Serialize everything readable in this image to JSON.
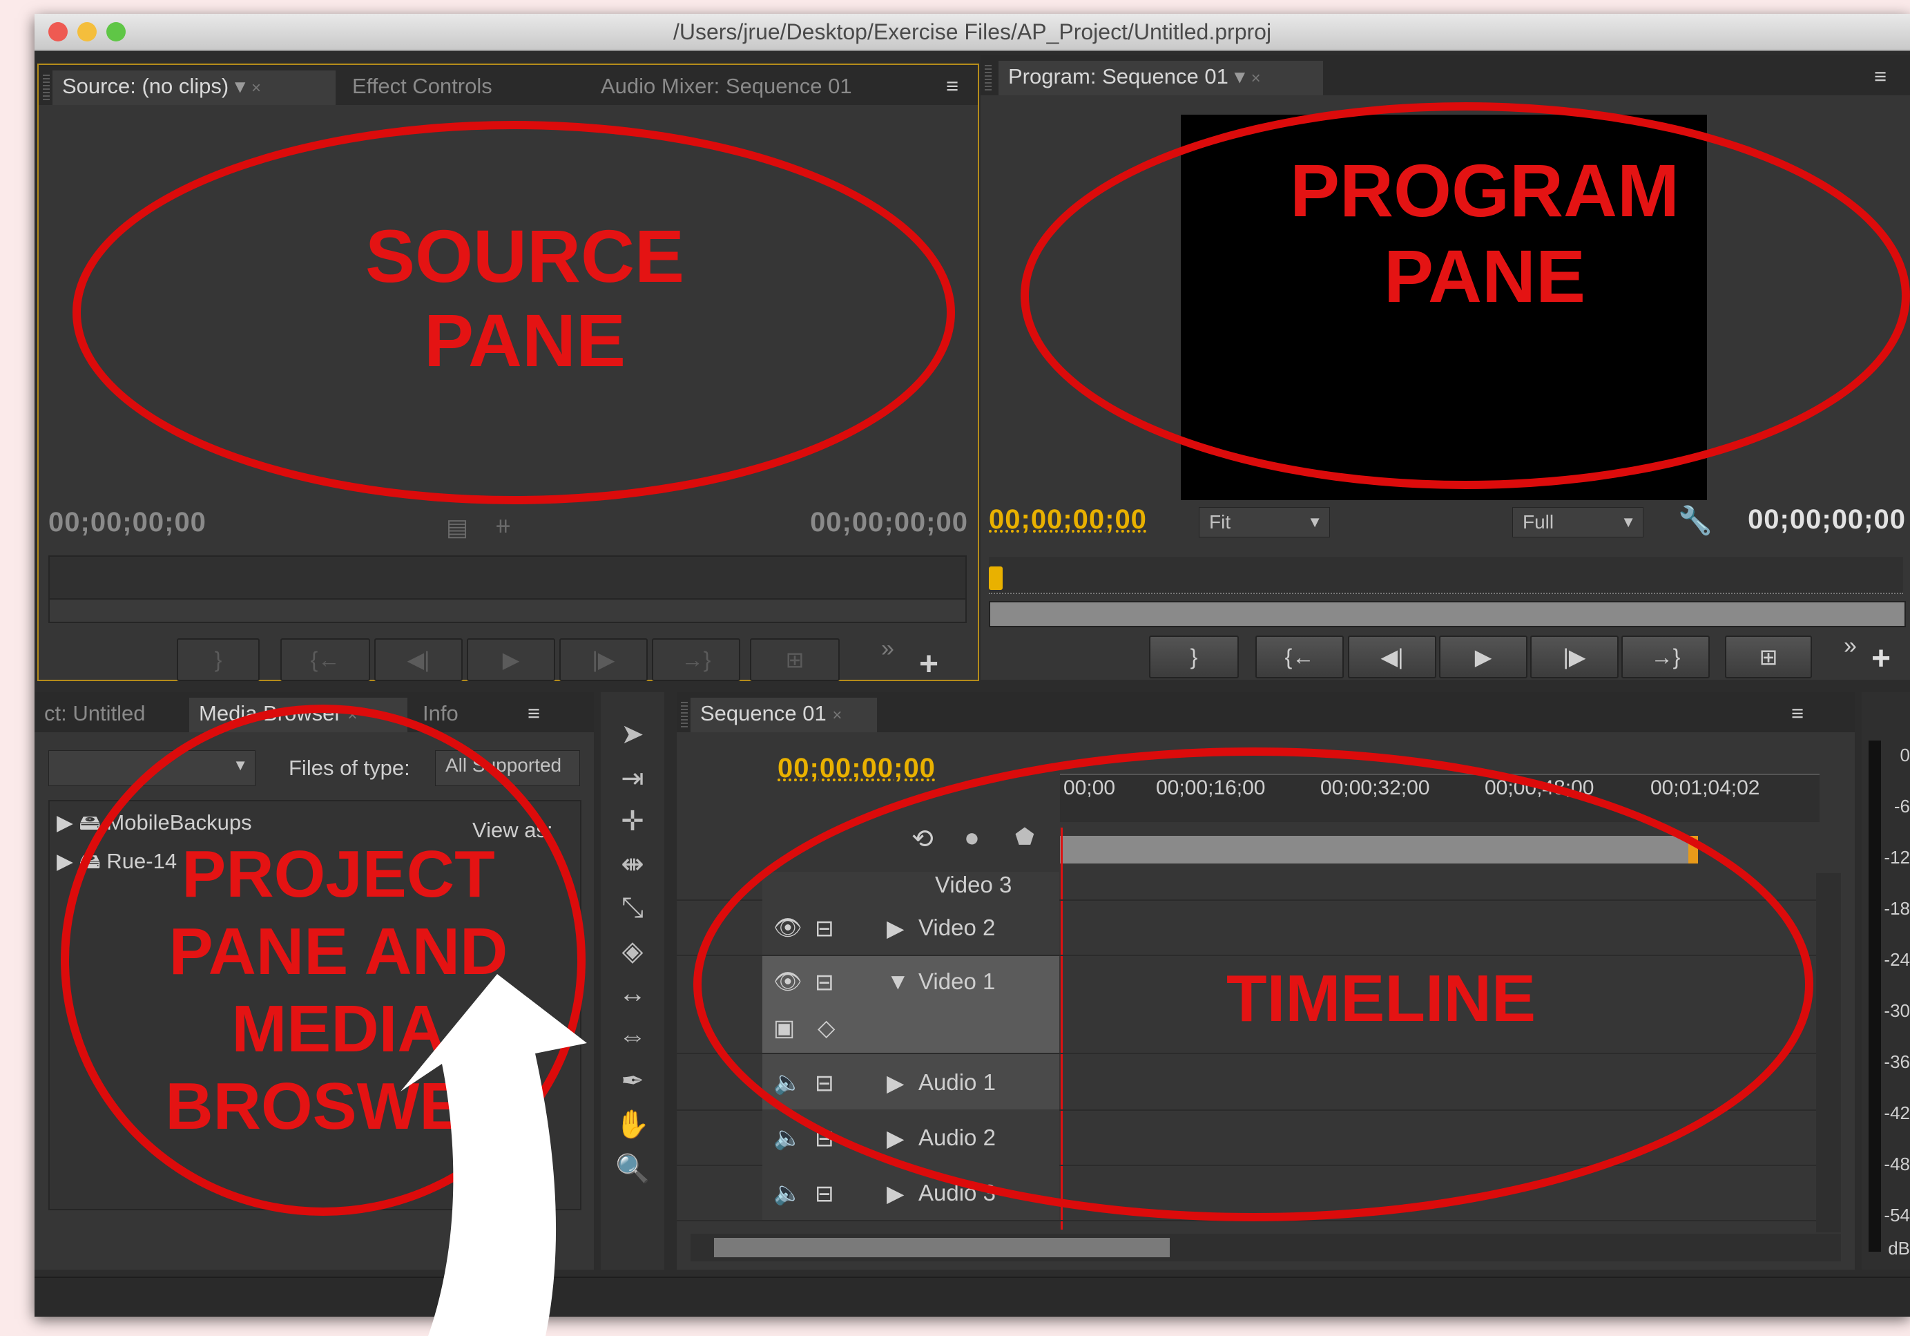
{
  "window": {
    "title": "/Users/jrue/Desktop/Exercise Files/AP_Project/Untitled.prproj"
  },
  "source": {
    "tabs": [
      "Source: (no clips)",
      "Effect Controls",
      "Audio Mixer: Sequence 01"
    ],
    "timecode_left": "00;00;00;00",
    "timecode_right": "00;00;00;00"
  },
  "program": {
    "tab": "Program: Sequence 01",
    "timecode_left": "00;00;00;00",
    "timecode_right": "00;00;00;00",
    "fit_label": "Fit",
    "quality_label": "Full"
  },
  "project": {
    "tabs": [
      "ct: Untitled",
      "Media Browser",
      "Info"
    ],
    "files_of_type_label": "Files of type:",
    "files_of_type_value": "All Supported",
    "view_as_label": "View as:",
    "items": [
      "MobileBackups",
      "Rue-14"
    ]
  },
  "timeline": {
    "tab": "Sequence 01",
    "timecode": "00;00;00;00",
    "ruler": [
      "00;00",
      "00;00;16;00",
      "00;00;32;00",
      "00;00;48;00",
      "00;01;04;02"
    ],
    "tracks": [
      "Video 3",
      "Video 2",
      "Video 1",
      "Audio 1",
      "Audio 2",
      "Audio 3"
    ]
  },
  "meter": {
    "scale": [
      "0",
      "-6",
      "-12",
      "-18",
      "-24",
      "-30",
      "-36",
      "-42",
      "-48",
      "-54",
      "dB"
    ]
  },
  "annotations": {
    "source": "SOURCE\nPANE",
    "program": "PROGRAM\nPANE",
    "project": "PROJECT\nPANE AND\nMEDIA\nBROSWER",
    "timeline": "TIMELINE",
    "color": "#e41313"
  }
}
